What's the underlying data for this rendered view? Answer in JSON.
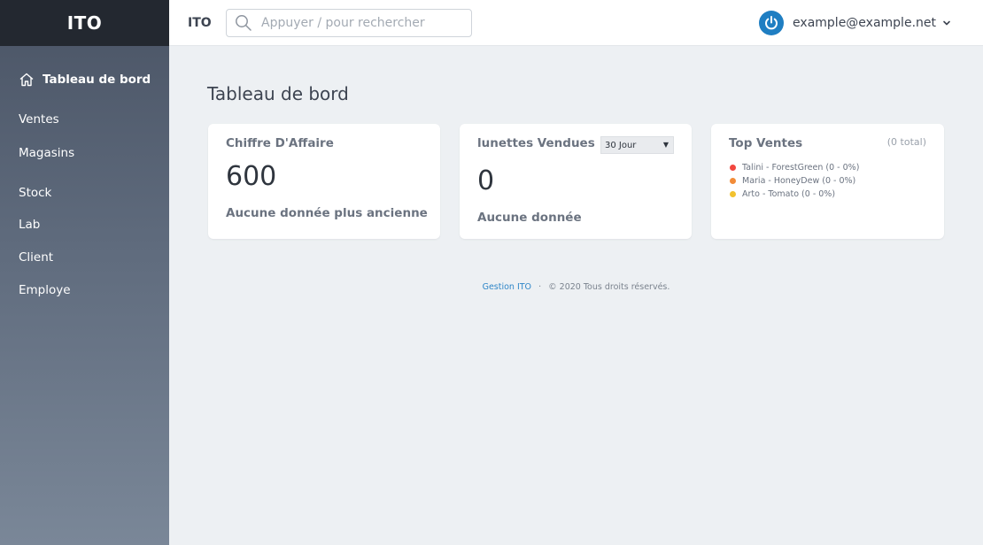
{
  "sidebar": {
    "brand": "ITO",
    "items": [
      {
        "label": "Tableau de bord",
        "icon": "home-icon",
        "active": true
      },
      {
        "label": "Ventes"
      },
      {
        "label": "Magasins"
      },
      {
        "label": "Stock"
      },
      {
        "label": "Lab"
      },
      {
        "label": "Client"
      },
      {
        "label": "Employe"
      }
    ]
  },
  "header": {
    "app_label": "ITO",
    "search": {
      "placeholder": "Appuyer / pour rechercher",
      "value": ""
    },
    "user": {
      "email": "example@example.net",
      "avatar_icon": "power-icon",
      "accent": "#1f7ec2"
    }
  },
  "page": {
    "title": "Tableau de bord"
  },
  "cards": {
    "revenue": {
      "title": "Chiffre D'Affaire",
      "value": "600",
      "subtitle": "Aucune donnée plus ancienne"
    },
    "glasses": {
      "title": "lunettes Vendues",
      "value": "0",
      "subtitle": "Aucune donnée",
      "period": "30 Jour"
    },
    "top": {
      "title": "Top Ventes",
      "total": "(0 total)",
      "items": [
        {
          "label": "Talini - ForestGreen (0 - 0%)",
          "color": "#f2473f"
        },
        {
          "label": "Maria - HoneyDew (0 - 0%)",
          "color": "#f28c38"
        },
        {
          "label": "Arto - Tomato (0 - 0%)",
          "color": "#f2c22f"
        }
      ]
    }
  },
  "footer": {
    "link": "Gestion ITO",
    "separator": "·",
    "text": "© 2020 Tous droits réservés."
  }
}
